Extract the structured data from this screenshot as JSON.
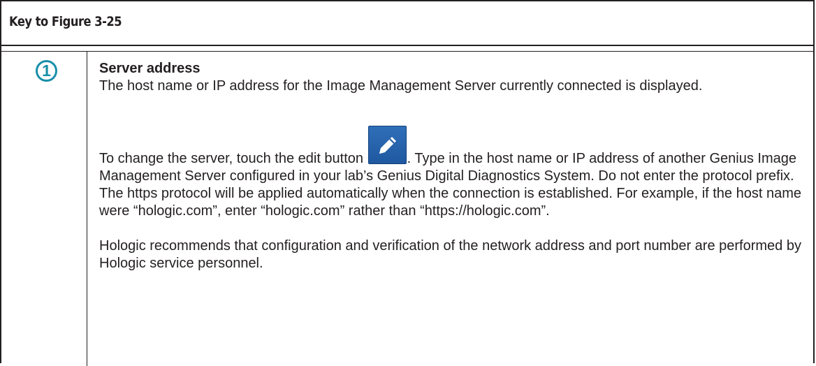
{
  "table": {
    "header_title": "Key to Figure 3-25"
  },
  "items": [
    {
      "callout_number": "1",
      "heading": "Server address",
      "para1": "The host name or IP address for the Image Management Server currently connected is displayed.",
      "para2_before_icon": "To change the server, touch the edit button ",
      "edit_icon": "pencil-edit-icon",
      "para2_after_icon": ". Type in the host name or IP address of another Genius Image Management Server configured in your lab’s Genius Digital Diagnostics System. Do not enter the protocol prefix. The https protocol will be applied automatically when the connection is established. For example, if the host name were “hologic.com”, enter “hologic.com” rather than “https://hologic.com”.",
      "para3": "Hologic recommends that configuration and verification of the network address and port number are performed by Hologic service personnel."
    }
  ],
  "colors": {
    "callout_accent": "#1a8fa8",
    "edit_button_blue": "#2f6fb8",
    "border": "#231f20",
    "text": "#231f20"
  }
}
